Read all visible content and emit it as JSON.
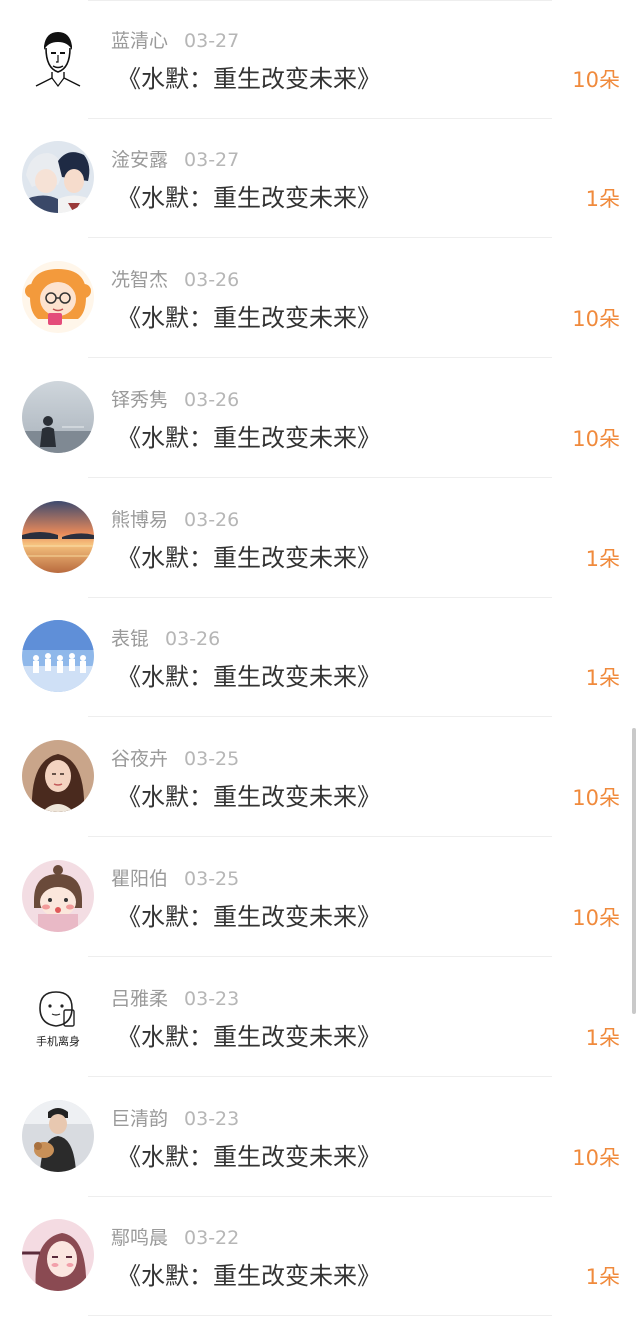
{
  "title_prefix": "《水默：重生改变未来》",
  "colors": {
    "amount": "#f08a3c",
    "username": "#9a9a9a",
    "title": "#333333"
  },
  "records": [
    {
      "username": "蓝清心",
      "date": "03-27",
      "title": "《水默：重生改变未来》",
      "amount": "10朵",
      "avatar_icon": "sketch-man-avatar-icon"
    },
    {
      "username": "淦安露",
      "date": "03-27",
      "title": "《水默：重生改变未来》",
      "amount": "1朵",
      "avatar_icon": "anime-boys-avatar-icon"
    },
    {
      "username": "冼智杰",
      "date": "03-26",
      "title": "《水默：重生改变未来》",
      "amount": "10朵",
      "avatar_icon": "anime-girl-glasses-avatar-icon"
    },
    {
      "username": "铎秀隽",
      "date": "03-26",
      "title": "《水默：重生改变未来》",
      "amount": "10朵",
      "avatar_icon": "silhouette-girl-avatar-icon"
    },
    {
      "username": "熊博易",
      "date": "03-26",
      "title": "《水默：重生改变未来》",
      "amount": "1朵",
      "avatar_icon": "sunset-sea-avatar-icon"
    },
    {
      "username": "表锟",
      "date": "03-26",
      "title": "《水默：重生改变未来》",
      "amount": "1朵",
      "avatar_icon": "stage-group-avatar-icon"
    },
    {
      "username": "谷夜卉",
      "date": "03-25",
      "title": "《水默：重生改变未来》",
      "amount": "10朵",
      "avatar_icon": "woman-photo-avatar-icon"
    },
    {
      "username": "瞿阳伯",
      "date": "03-25",
      "title": "《水默：重生改变未来》",
      "amount": "10朵",
      "avatar_icon": "cartoon-girl-avatar-icon"
    },
    {
      "username": "吕雅柔",
      "date": "03-23",
      "title": "《水默：重生改变未来》",
      "amount": "1朵",
      "avatar_icon": "meme-phone-avatar-icon",
      "avatar_text": "手机离身"
    },
    {
      "username": "巨清韵",
      "date": "03-23",
      "title": "《水默：重生改变未来》",
      "amount": "10朵",
      "avatar_icon": "man-with-dog-avatar-icon"
    },
    {
      "username": "鄢鸣晨",
      "date": "03-22",
      "title": "《水默：重生改变未来》",
      "amount": "1朵",
      "avatar_icon": "anime-girl-pink-avatar-icon"
    }
  ]
}
